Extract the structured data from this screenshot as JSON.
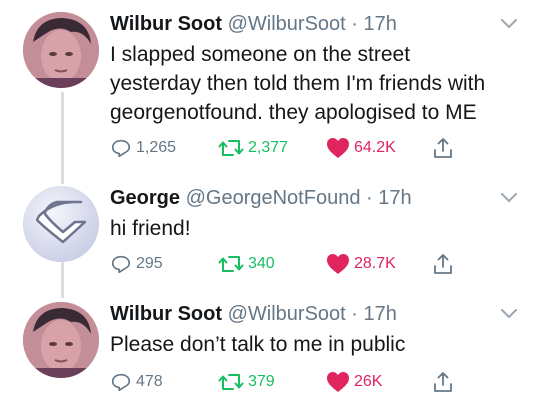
{
  "tweets": [
    {
      "name": "Wilbur Soot",
      "handle": "@WilburSoot",
      "time": "· 17h",
      "lines": [
        "I slapped someone on the street",
        "yesterday then told them I'm friends with",
        "georgenotfound. they apologised to ME"
      ],
      "replies": "1,265",
      "retweets": "2,377",
      "likes": "64.2K",
      "avatar": "wilbur-avatar"
    },
    {
      "name": "George",
      "handle": "@GeorgeNotFound",
      "time": "· 17h",
      "lines": [
        "hi friend!"
      ],
      "replies": "295",
      "retweets": "340",
      "likes": "28.7K",
      "avatar": "george-avatar"
    },
    {
      "name": "Wilbur Soot",
      "handle": "@WilburSoot",
      "time": "· 17h",
      "lines": [
        "Please don’t talk to me in public"
      ],
      "replies": "478",
      "retweets": "379",
      "likes": "26K",
      "avatar": "wilbur-avatar"
    }
  ],
  "colors": {
    "retweet": "#17bf63",
    "like": "#e0245e",
    "muted": "#657786",
    "thread_line": "#d7dde2"
  },
  "icons": [
    "reply-icon",
    "retweet-icon",
    "heart-icon",
    "share-icon",
    "chevron-down-icon"
  ]
}
